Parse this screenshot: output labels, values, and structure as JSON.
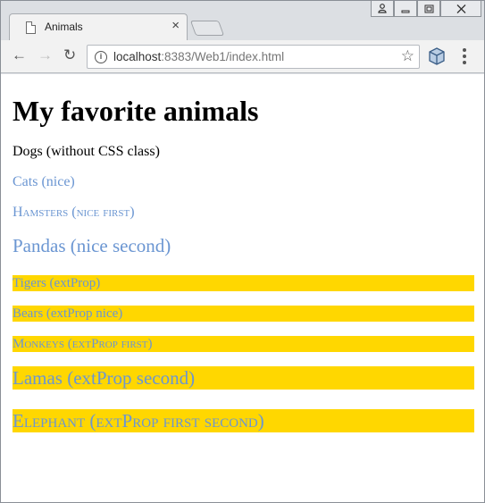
{
  "window": {
    "controls": [
      "profile-icon",
      "minimize-icon",
      "maximize-icon",
      "close-icon"
    ]
  },
  "tab": {
    "title": "Animals",
    "close_glyph": "×"
  },
  "toolbar": {
    "url_host": "localhost",
    "url_rest": ":8383/Web1/index.html"
  },
  "page": {
    "heading": "My favorite animals",
    "items": [
      {
        "text": "Dogs (without CSS class)",
        "classes": []
      },
      {
        "text": "Cats (nice)",
        "classes": [
          "nice"
        ]
      },
      {
        "text": "Hamsters (nice first)",
        "classes": [
          "nice",
          "first"
        ]
      },
      {
        "text": "Pandas (nice second)",
        "classes": [
          "nice",
          "second"
        ]
      },
      {
        "text": "Tigers (extProp)",
        "classes": [
          "extProp"
        ]
      },
      {
        "text": "Bears (extProp nice)",
        "classes": [
          "extProp",
          "nice"
        ]
      },
      {
        "text": "Monkeys (extProp first)",
        "classes": [
          "extProp",
          "first"
        ]
      },
      {
        "text": "Lamas (extProp second)",
        "classes": [
          "extProp",
          "second"
        ]
      },
      {
        "text": "Elephant (extProp first second)",
        "classes": [
          "extProp",
          "first",
          "second"
        ]
      }
    ]
  },
  "colors": {
    "nice_text": "#6b96d2",
    "extProp_background": "#ffd700"
  }
}
